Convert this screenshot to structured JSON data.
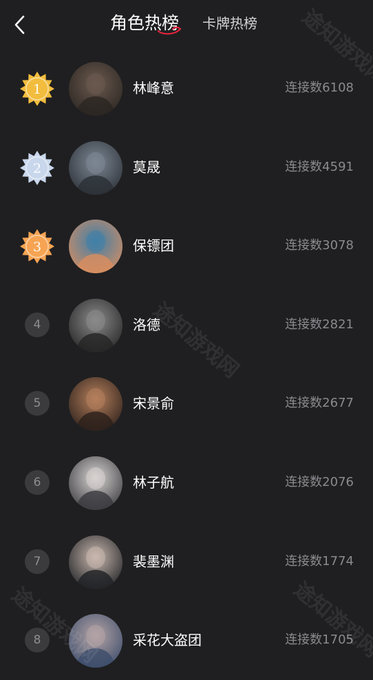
{
  "header": {
    "back_icon": "chevron-left-icon",
    "tab_active": "角色热榜",
    "tab_inactive": "卡牌热榜"
  },
  "watermark": "途知游戏网",
  "rankings": [
    {
      "rank": "1",
      "name": "林峰意",
      "count": "连接数6108",
      "medal": "gold",
      "avatar_colors": [
        "#2a2522",
        "#6b5a4e"
      ]
    },
    {
      "rank": "2",
      "name": "莫晟",
      "count": "连接数4591",
      "medal": "silver",
      "avatar_colors": [
        "#2b3036",
        "#7d8794"
      ]
    },
    {
      "rank": "3",
      "name": "保镖团",
      "count": "连接数3078",
      "medal": "bronze",
      "avatar_colors": [
        "#d98d5f",
        "#3f7fa8"
      ]
    },
    {
      "rank": "4",
      "name": "洛德",
      "count": "连接数2821",
      "medal": "",
      "avatar_colors": [
        "#242424",
        "#8a8a8a"
      ]
    },
    {
      "rank": "5",
      "name": "宋景俞",
      "count": "连接数2677",
      "medal": "",
      "avatar_colors": [
        "#2a1f1a",
        "#b57f5c"
      ]
    },
    {
      "rank": "6",
      "name": "林子航",
      "count": "连接数2076",
      "medal": "",
      "avatar_colors": [
        "#3a3a3e",
        "#d8d4d2"
      ]
    },
    {
      "rank": "7",
      "name": "裴墨渊",
      "count": "连接数1774",
      "medal": "",
      "avatar_colors": [
        "#1e2024",
        "#c9b8ae"
      ]
    },
    {
      "rank": "8",
      "name": "采花大盗团",
      "count": "连接数1705",
      "medal": "",
      "avatar_colors": [
        "#3c4c6a",
        "#b4a4a6"
      ]
    }
  ],
  "colors": {
    "background": "#1f1f21",
    "gold": "#f2bd3e",
    "silver": "#c9d7ec",
    "bronze": "#f6a453",
    "accent_underline": "#e0253c"
  }
}
